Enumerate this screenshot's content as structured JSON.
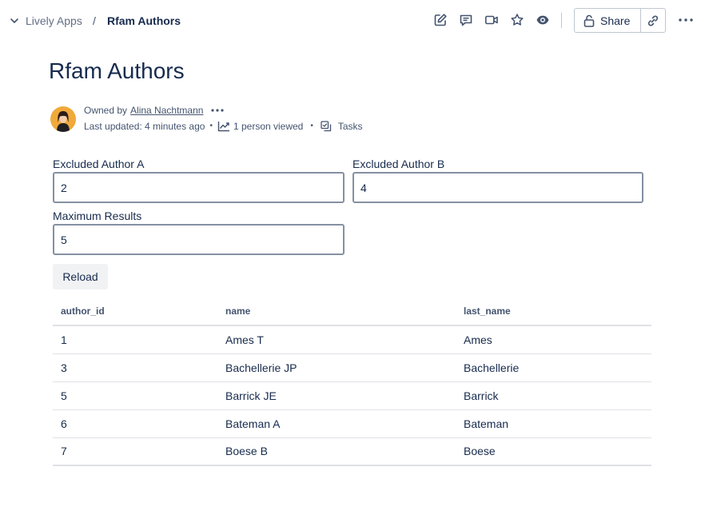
{
  "breadcrumb": {
    "space": "Lively Apps",
    "separator": "/",
    "page": "Rfam Authors"
  },
  "toolbar": {
    "icons": [
      "edit-icon",
      "comment-icon",
      "video-icon",
      "star-icon",
      "watch-icon"
    ],
    "share_label": "Share",
    "link_icon": "link-icon",
    "more_icon": "more-icon"
  },
  "page": {
    "title": "Rfam Authors"
  },
  "byline": {
    "owned_by_prefix": "Owned by",
    "owner": "Alina Nachtmann",
    "last_updated": "Last updated: 4 minutes ago",
    "views": "1 person viewed",
    "tasks": "Tasks"
  },
  "form": {
    "excluded_a": {
      "label": "Excluded Author A",
      "value": "2"
    },
    "excluded_b": {
      "label": "Excluded Author B",
      "value": "4"
    },
    "max_results": {
      "label": "Maximum Results",
      "value": "5"
    },
    "reload_label": "Reload"
  },
  "table": {
    "columns": [
      "author_id",
      "name",
      "last_name"
    ],
    "rows": [
      [
        "1",
        "Ames T",
        "Ames"
      ],
      [
        "3",
        "Bachellerie JP",
        "Bachellerie"
      ],
      [
        "5",
        "Barrick JE",
        "Barrick"
      ],
      [
        "6",
        "Bateman A",
        "Bateman"
      ],
      [
        "7",
        "Boese B",
        "Boese"
      ]
    ]
  },
  "colors": {
    "text": "#172b4d",
    "subtle_text": "#44546f",
    "border": "#8590a2",
    "button_bg": "#f1f2f4"
  }
}
